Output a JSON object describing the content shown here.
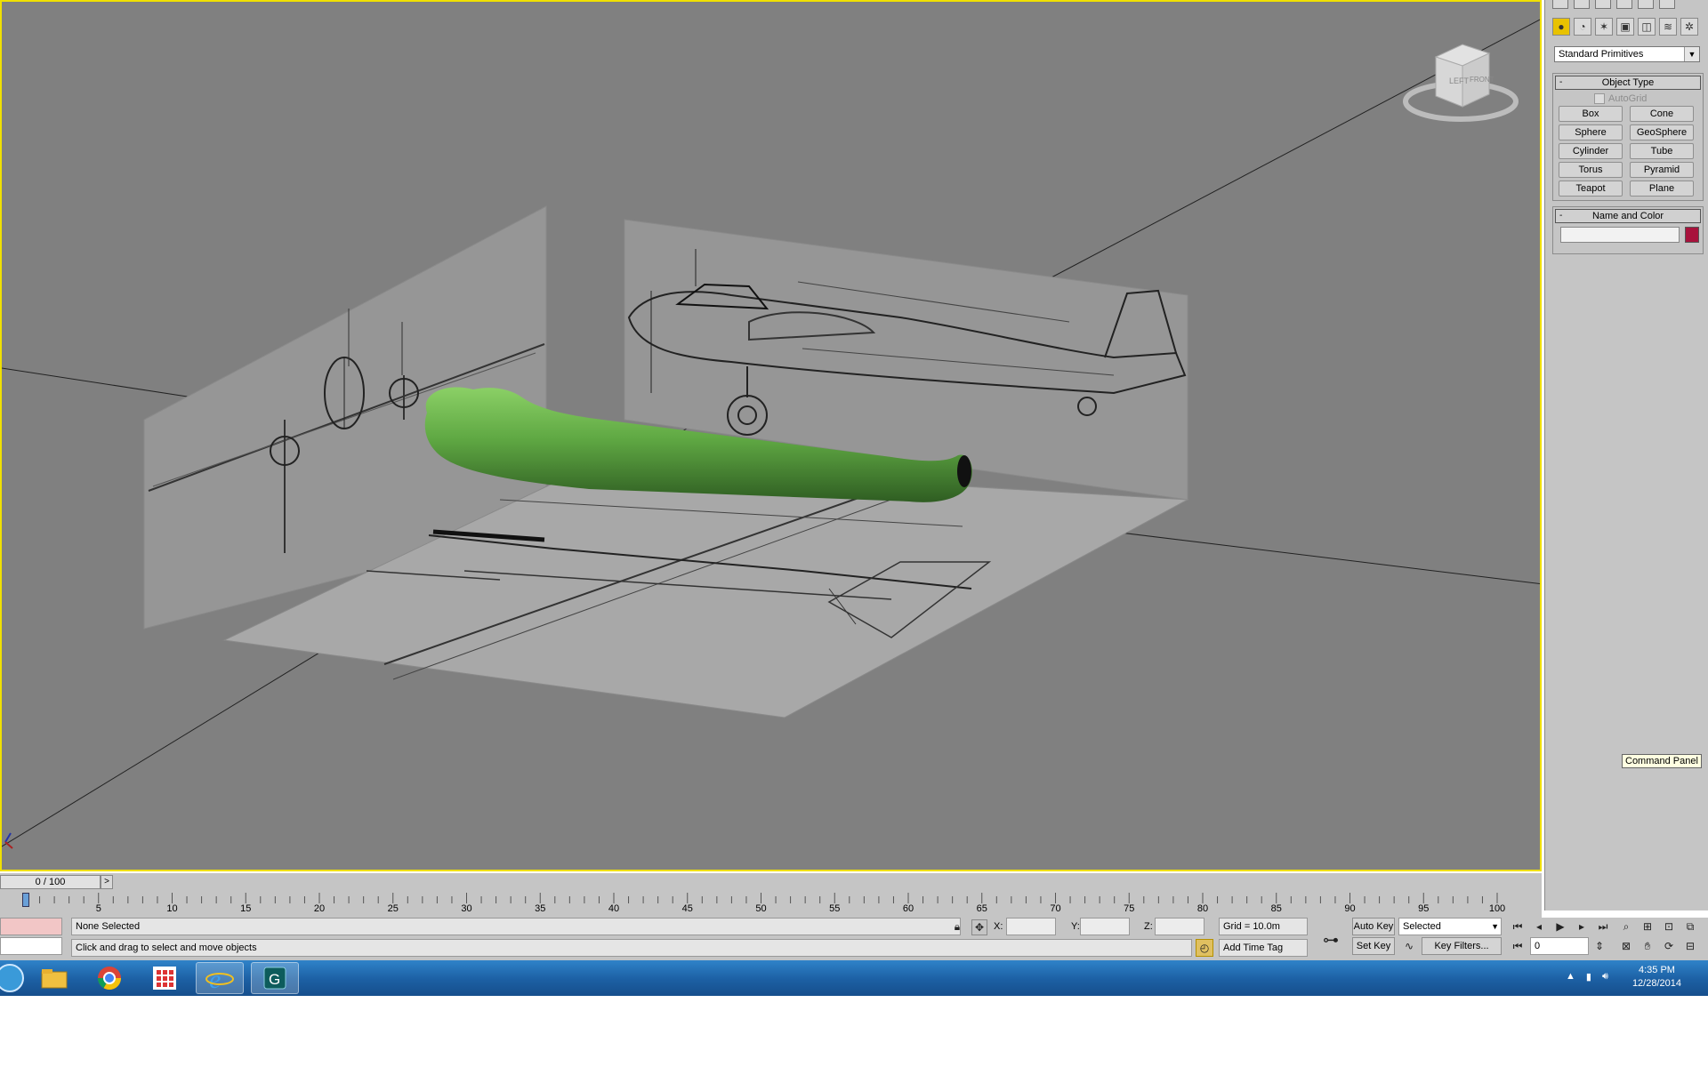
{
  "command_panel": {
    "category_dropdown": "Standard Primitives",
    "object_type": {
      "title": "Object Type",
      "autogrid_label": "AutoGrid",
      "buttons": [
        "Box",
        "Cone",
        "Sphere",
        "GeoSphere",
        "Cylinder",
        "Tube",
        "Torus",
        "Pyramid",
        "Teapot",
        "Plane"
      ]
    },
    "name_and_color": {
      "title": "Name and Color",
      "name_value": "",
      "color": "#a8123c"
    },
    "tooltip": "Command Panel"
  },
  "viewcube": {
    "left_label": "LEFT",
    "front_label": "FRONT"
  },
  "timeline": {
    "slider_label": "0 / 100",
    "next_label": ">",
    "ticks": [
      "5",
      "10",
      "15",
      "20",
      "25",
      "30",
      "35",
      "40",
      "45",
      "50",
      "55",
      "60",
      "65",
      "70",
      "75",
      "80",
      "85",
      "90",
      "95",
      "100"
    ]
  },
  "status": {
    "selection": "None Selected",
    "prompt": "Click and drag to select and move objects",
    "x_label": "X:",
    "y_label": "Y:",
    "z_label": "Z:",
    "x_value": "",
    "y_value": "",
    "z_value": "",
    "grid": "Grid = 10.0m",
    "add_time_tag": "Add Time Tag",
    "auto_key": "Auto Key",
    "set_key": "Set Key",
    "selected_dropdown": "Selected",
    "key_filters": "Key Filters...",
    "frame_value": "0"
  },
  "taskbar": {
    "time": "4:35 PM",
    "date": "12/28/2014"
  },
  "colors": {
    "viewport_bg": "#808080",
    "active_border": "#f0e000",
    "fuselage": "#5fa843"
  }
}
